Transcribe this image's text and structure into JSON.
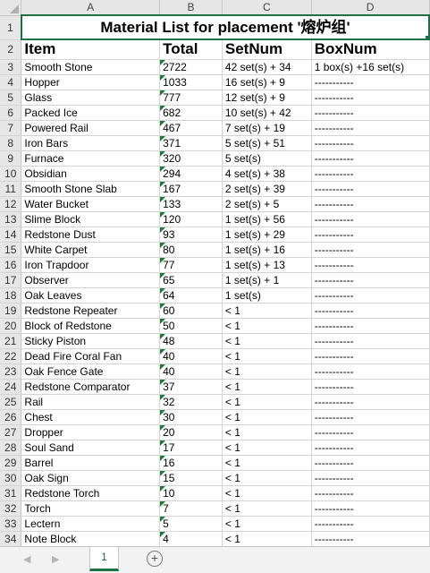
{
  "columns": [
    "A",
    "B",
    "C",
    "D"
  ],
  "title": "Material List for placement '熔炉组'",
  "headers": [
    "Item",
    "Total",
    "SetNum",
    "BoxNum"
  ],
  "rows": [
    [
      "3",
      "Smooth Stone",
      "2722",
      "42 set(s) + 34",
      "1 box(s) +16 set(s)"
    ],
    [
      "4",
      "Hopper",
      "1033",
      "16 set(s) + 9",
      "-----------"
    ],
    [
      "5",
      "Glass",
      "777",
      "12 set(s) + 9",
      "-----------"
    ],
    [
      "6",
      "Packed Ice",
      "682",
      "10 set(s) + 42",
      "-----------"
    ],
    [
      "7",
      "Powered Rail",
      "467",
      "7 set(s) + 19",
      "-----------"
    ],
    [
      "8",
      "Iron Bars",
      "371",
      "5 set(s) + 51",
      "-----------"
    ],
    [
      "9",
      "Furnace",
      "320",
      "5 set(s)",
      "-----------"
    ],
    [
      "10",
      "Obsidian",
      "294",
      "4 set(s) + 38",
      "-----------"
    ],
    [
      "11",
      "Smooth Stone Slab",
      "167",
      "2 set(s) + 39",
      "-----------"
    ],
    [
      "12",
      "Water Bucket",
      "133",
      "2 set(s) + 5",
      "-----------"
    ],
    [
      "13",
      "Slime Block",
      "120",
      "1 set(s) + 56",
      "-----------"
    ],
    [
      "14",
      "Redstone Dust",
      "93",
      "1 set(s) + 29",
      "-----------"
    ],
    [
      "15",
      "White Carpet",
      "80",
      "1 set(s) + 16",
      "-----------"
    ],
    [
      "16",
      "Iron Trapdoor",
      "77",
      "1 set(s) + 13",
      "-----------"
    ],
    [
      "17",
      "Observer",
      "65",
      "1 set(s) + 1",
      "-----------"
    ],
    [
      "18",
      "Oak Leaves",
      "64",
      "1 set(s)",
      "-----------"
    ],
    [
      "19",
      "Redstone Repeater",
      "60",
      "< 1",
      "-----------"
    ],
    [
      "20",
      "Block of Redstone",
      "50",
      "< 1",
      "-----------"
    ],
    [
      "21",
      "Sticky Piston",
      "48",
      "< 1",
      "-----------"
    ],
    [
      "22",
      "Dead Fire Coral Fan",
      "40",
      "< 1",
      "-----------"
    ],
    [
      "23",
      "Oak Fence Gate",
      "40",
      "< 1",
      "-----------"
    ],
    [
      "24",
      "Redstone Comparator",
      "37",
      "< 1",
      "-----------"
    ],
    [
      "25",
      "Rail",
      "32",
      "< 1",
      "-----------"
    ],
    [
      "26",
      "Chest",
      "30",
      "< 1",
      "-----------"
    ],
    [
      "27",
      "Dropper",
      "20",
      "< 1",
      "-----------"
    ],
    [
      "28",
      "Soul Sand",
      "17",
      "< 1",
      "-----------"
    ],
    [
      "29",
      "Barrel",
      "16",
      "< 1",
      "-----------"
    ],
    [
      "30",
      "Oak Sign",
      "15",
      "< 1",
      "-----------"
    ],
    [
      "31",
      "Redstone Torch",
      "10",
      "< 1",
      "-----------"
    ],
    [
      "32",
      "Torch",
      "7",
      "< 1",
      "-----------"
    ],
    [
      "33",
      "Lectern",
      "5",
      "< 1",
      "-----------"
    ],
    [
      "34",
      "Note Block",
      "4",
      "< 1",
      "-----------"
    ]
  ],
  "tabs": {
    "nav_prev": "◀",
    "nav_next": "▶",
    "sheet_name": "1",
    "add_symbol": "+"
  }
}
